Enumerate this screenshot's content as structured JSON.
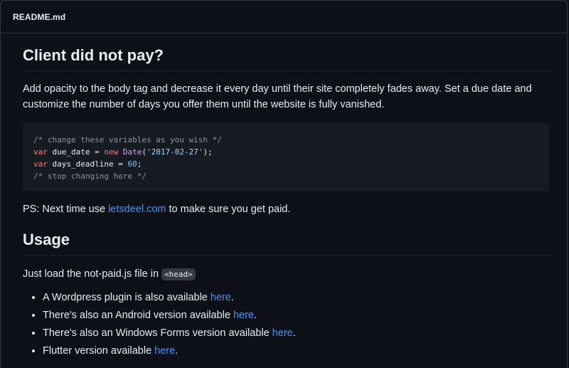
{
  "file_header": {
    "name": "README.md"
  },
  "section_client": {
    "heading": "Client did not pay?",
    "intro": "Add opacity to the body tag and decrease it every day until their site completely fades away. Set a due date and customize the number of days you offer them until the website is fully vanished.",
    "code": {
      "line1_comment": "/* change these variables as you wish */",
      "line2_kw": "var",
      "line2_name": " due_date = ",
      "line2_new": "new",
      "line2_space": " ",
      "line2_class": "Date",
      "line2_open": "(",
      "line2_string": "'2017-02-27'",
      "line2_close": ");",
      "line3_kw": "var",
      "line3_name": " days_deadline = ",
      "line3_number": "60",
      "line3_end": ";",
      "line4_comment": "/* stop changing here */"
    },
    "ps_prefix": "PS: Next time use ",
    "ps_link": "letsdeel.com",
    "ps_suffix": " to make sure you get paid."
  },
  "section_usage": {
    "heading": "Usage",
    "load_prefix": "Just load the not-paid.js file in ",
    "load_code": "<head>",
    "items": [
      {
        "text": "A Wordpress plugin is also available ",
        "link": "here",
        "end": "."
      },
      {
        "text": "There's also an Android version available ",
        "link": "here",
        "end": "."
      },
      {
        "text": "There's also an Windows Forms version available ",
        "link": "here",
        "end": "."
      },
      {
        "text": "Flutter version available ",
        "link": "here",
        "end": "."
      }
    ]
  },
  "colors": {
    "background": "#0d1117",
    "code_background": "#161b22",
    "link": "#4493f8",
    "text": "#e6edf3"
  }
}
